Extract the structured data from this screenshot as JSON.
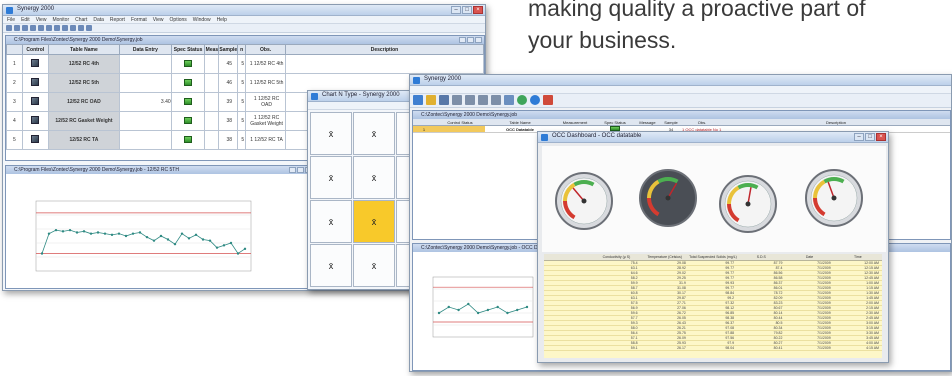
{
  "hero": {
    "line1": "making quality a proactive part of",
    "line2": "your business."
  },
  "left_window": {
    "title": "Synergy 2000",
    "menu": [
      "File",
      "Edit",
      "View",
      "Monitor",
      "Chart",
      "Data",
      "Report",
      "Format",
      "View",
      "Options",
      "Window",
      "Help"
    ],
    "table_window_title": "C:\\Program Files\\Zontec\\Synergy 2000 Demo\\Synergy.job",
    "columns": [
      "",
      "Control",
      "Table Name",
      "Data Entry",
      "Spec Status",
      "Meas",
      "Sample",
      "n",
      "Obs.",
      "Description"
    ],
    "rows": [
      {
        "n": "1",
        "name": "12/52 RC 4th",
        "entry": "",
        "meas": "",
        "sample": "45",
        "count": "5",
        "obs": "1 12/52 RC 4th"
      },
      {
        "n": "2",
        "name": "12/52 RC 5th",
        "entry": "",
        "meas": "",
        "sample": "46",
        "count": "5",
        "obs": "1 12/52 RC 5th"
      },
      {
        "n": "3",
        "name": "12/52 RC OAD",
        "entry": "3.40",
        "meas": "",
        "sample": "39",
        "count": "5",
        "obs": "1 12/52 RC OAD"
      },
      {
        "n": "4",
        "name": "12/52 RC Gasket Weight",
        "entry": "",
        "meas": "",
        "sample": "38",
        "count": "5",
        "obs": "1 12/52 RC Gasket Weight"
      },
      {
        "n": "5",
        "name": "12/52 RC TA",
        "entry": "",
        "meas": "",
        "sample": "38",
        "count": "5",
        "obs": "1 12/52 RC TA"
      }
    ],
    "chart_window_title": "C:\\Program Files\\Zontec\\Synergy 2000 Demo\\Synergy.job - 12/52 RC 5TH"
  },
  "tile_dialog": {
    "title": "Chart N Type - Synergy 2000",
    "tiles": [
      "x̄",
      "x̄",
      "",
      "x̄",
      "x̄",
      "",
      "x̄",
      "x̄",
      "",
      "x̄",
      "x̄",
      ""
    ]
  },
  "right_window": {
    "title": "Synergy 2000",
    "table_window_title": "C:\\Zontec\\Synergy 2000 Demo\\Synergy.job",
    "row": {
      "num": "1",
      "name": "OCC Datatable",
      "sample": "34",
      "n": "1",
      "obs": "1 OCC datatable No 1"
    },
    "dashboard_title": "OCC Dashboard - OCC datatable",
    "data_window_title": "C:\\Zontec\\Synergy 2000 Demo\\Synergy.job - OCC Datatable",
    "data_columns": [
      "",
      "Conductivity (μ S)",
      "Temperature (Celsius)",
      "Total Suspended Solids (mg/L)",
      "S.D.S",
      "Date",
      "Time"
    ],
    "data_rows": [
      [
        "",
        "75.4",
        "29.08",
        "99.77",
        "87.79",
        "7/1/2009",
        "12:00 AM"
      ],
      [
        "",
        "63.1",
        "28.92",
        "99.77",
        "87.4",
        "7/1/2009",
        "12:15 AM"
      ],
      [
        "",
        "64.6",
        "29.02",
        "99.77",
        "86.56",
        "7/1/2009",
        "12:30 AM"
      ],
      [
        "",
        "58.2",
        "29.25",
        "99.77",
        "86.58",
        "7/1/2009",
        "12:45 AM"
      ],
      [
        "",
        "59.9",
        "31.9",
        "99.93",
        "86.37",
        "7/1/2009",
        "1:00 AM"
      ],
      [
        "",
        "58.7",
        "31.08",
        "99.77",
        "86.01",
        "7/1/2009",
        "1:15 AM"
      ],
      [
        "",
        "60.8",
        "30.17",
        "98.84",
        "78.72",
        "7/1/2009",
        "1:30 AM"
      ],
      [
        "",
        "63.1",
        "29.87",
        "99.2",
        "82.09",
        "7/1/2009",
        "1:45 AM"
      ],
      [
        "",
        "57.5",
        "27.71",
        "97.32",
        "83.23",
        "7/1/2009",
        "2:00 AM"
      ],
      [
        "",
        "56.9",
        "27.06",
        "98.12",
        "80.67",
        "7/1/2009",
        "2:15 AM"
      ],
      [
        "",
        "59.6",
        "26.72",
        "96.85",
        "80.14",
        "7/1/2009",
        "2:30 AM"
      ],
      [
        "",
        "57.7",
        "26.05",
        "98.38",
        "80.44",
        "7/1/2009",
        "2:45 AM"
      ],
      [
        "",
        "59.3",
        "26.43",
        "96.37",
        "80.5",
        "7/1/2009",
        "3:00 AM"
      ],
      [
        "",
        "58.0",
        "26.21",
        "97.08",
        "80.34",
        "7/1/2009",
        "3:15 AM"
      ],
      [
        "",
        "56.4",
        "25.75",
        "97.88",
        "79.82",
        "7/1/2009",
        "3:30 AM"
      ],
      [
        "",
        "57.1",
        "26.09",
        "97.56",
        "80.22",
        "7/1/2009",
        "3:45 AM"
      ],
      [
        "",
        "58.8",
        "25.93",
        "97.9",
        "80.27",
        "7/1/2009",
        "4:00 AM"
      ],
      [
        "",
        "59.1",
        "26.17",
        "98.04",
        "80.41",
        "7/1/2009",
        "4:15 AM"
      ]
    ]
  },
  "colors": {
    "accent": "#2e7bd6",
    "highlight_tile": "#f8c92a",
    "spec_limit": "#d45050",
    "series": "#2f8a83"
  },
  "chart_data": [
    {
      "type": "line",
      "title": "",
      "xlabel": "",
      "ylabel": "",
      "series": [
        {
          "values": [
            2.55,
            2.72,
            2.75,
            2.74,
            2.75,
            2.73,
            2.74,
            2.72,
            2.73,
            2.72,
            2.71,
            2.72,
            2.7,
            2.72,
            2.73,
            2.69,
            2.66,
            2.7,
            2.67,
            2.63,
            2.72,
            2.68,
            2.71,
            2.67,
            2.66,
            2.6,
            2.62,
            2.64,
            2.55,
            2.59
          ]
        }
      ],
      "ylim": [
        2.4,
        3.0
      ]
    },
    {
      "type": "line",
      "title": "",
      "xlabel": "",
      "ylabel": "",
      "series": [
        {
          "values": [
            68,
            70,
            69,
            71,
            68,
            69,
            70,
            68,
            69,
            70
          ]
        }
      ],
      "ylim": [
        60,
        80
      ]
    }
  ]
}
